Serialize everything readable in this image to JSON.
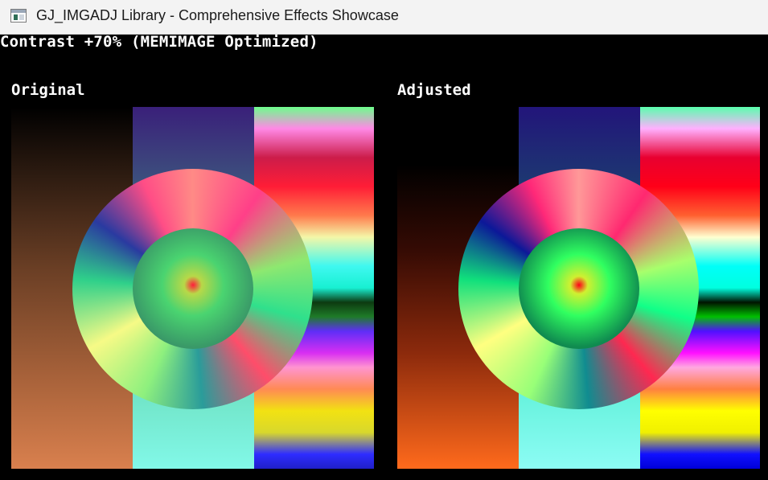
{
  "window": {
    "title": "GJ_IMGADJ Library - Comprehensive Effects Showcase",
    "icon": "app-window-icon"
  },
  "effect": {
    "title": "Contrast +70% (MEMIMAGE Optimized)"
  },
  "panels": {
    "original": {
      "label": "Original"
    },
    "adjusted": {
      "label": "Adjusted"
    }
  },
  "colors": {
    "background": "#000000",
    "titlebar": "#f3f3f3",
    "text": "#ffffff"
  }
}
